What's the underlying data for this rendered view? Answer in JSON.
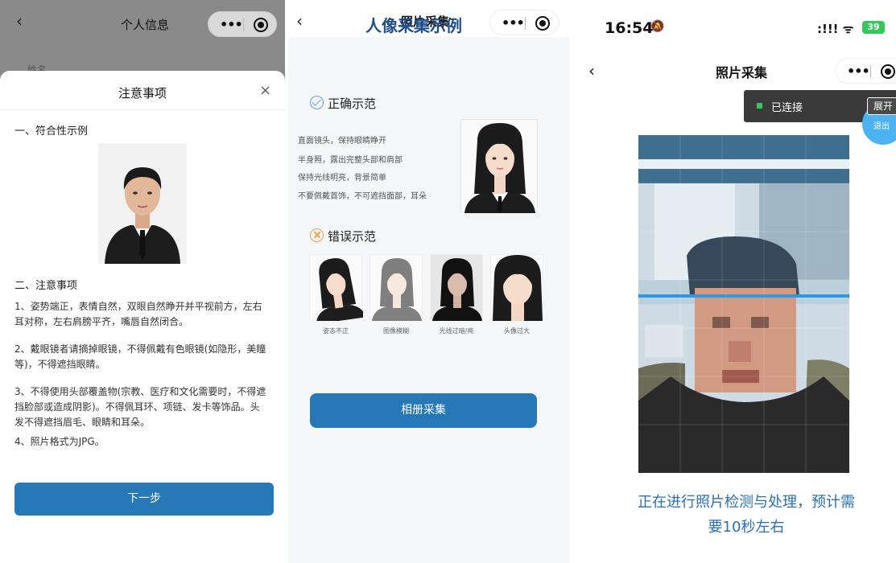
{
  "panel1": {
    "back_glyph": "‹",
    "nav_title": "个人信息",
    "faded_label": "姓名",
    "sheet_title": "注意事项",
    "close_glyph": "×",
    "section1": "一、符合性示例",
    "section2": "二、注意事项",
    "notes": [
      "1、姿势端正，表情自然，双眼自然睁开并平视前方，左右耳对称，左右肩膀平齐，嘴唇自然闭合。",
      "2、戴眼镜者请摘掉眼镜，不得佩戴有色眼镜(如隐形，美瞳等)，不得遮挡眼睛。",
      "3、不得使用头部覆盖物(宗教、医疗和文化需要时，不得遮挡脸部或造成阴影)。不得佩耳环、项链、发卡等饰品。头发不得遮挡眉毛、眼睛和耳朵。",
      "4、照片格式为JPG。"
    ],
    "next_button": "下一步"
  },
  "panel2": {
    "back_glyph": "‹",
    "nav_title": "照片采集",
    "page_title": "人像采集示例",
    "correct_head": "正确示范",
    "rules": [
      "直面镜头，保持眼睛睁开",
      "半身照，露出完整头部和肩部",
      "保持光线明亮，背景简单",
      "不要佩戴首饰，不可遮挡面部，耳朵"
    ],
    "wrong_head": "错误示范",
    "wrong_captions": [
      "姿态不正",
      "图像模糊",
      "光线过暗/亮",
      "头像过大"
    ],
    "album_button": "相册采集"
  },
  "panel3": {
    "status_time": "16:54",
    "mute_glyph": "🔕",
    "status_signal": ":!!! ᯤ",
    "battery": "39",
    "back_glyph": "‹",
    "nav_title": "照片采集",
    "connected_text": "已连接",
    "expand_button": "展开",
    "exit_button": "退出",
    "processing_text": "正在进行照片检测与处理，预计需要10秒左右"
  },
  "colors": {
    "brand_blue": "#2679b6",
    "title_blue": "#1f4e8a",
    "scan_blue": "#2f98e6",
    "connected_green": "#34c759"
  }
}
